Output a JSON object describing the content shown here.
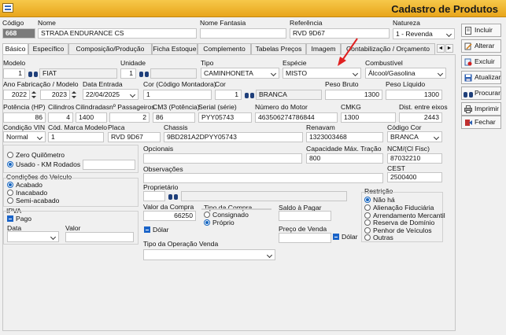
{
  "window": {
    "title": "Cadastro de Produtos"
  },
  "header": {
    "codigo_label": "Código",
    "codigo_value": "668",
    "nome_label": "Nome",
    "nome_value": "STRADA ENDURANCE CS",
    "nome_fantasia_label": "Nome Fantasia",
    "nome_fantasia_value": "",
    "referencia_label": "Referência",
    "referencia_value": "RVD 9D67",
    "natureza_label": "Natureza",
    "natureza_value": "1 - Revenda"
  },
  "tabs": [
    "Básico",
    "Específico",
    "Composição/Produção",
    "Ficha Estoque",
    "Complemento",
    "Tabelas Preços",
    "Imagem",
    "Contabilização / Orçamento"
  ],
  "tabnav": {
    "prev": "◄",
    "next": "►"
  },
  "form": {
    "modelo_label": "Modelo",
    "modelo_code": "1",
    "modelo_value": "FIAT",
    "unidade_label": "Unidade",
    "unidade_value": "1",
    "tipo_label": "Tipo",
    "tipo_value": "CAMINHONETA",
    "especie_label": "Espécie",
    "especie_value": "MISTO",
    "combustivel_label": "Combustível",
    "combustivel_value": "Álcool/Gasolina",
    "ano_label": "Ano Fabricação / Modelo",
    "ano_fab": "2022",
    "ano_mod": "2023",
    "data_entrada_label": "Data Entrada",
    "data_entrada_value": "22/04/2025",
    "cor_montadora_label": "Cor (Código Montadora)",
    "cor_montadora_value": "1",
    "cor_label": "Cor",
    "cor_code": "1",
    "cor_value": "BRANCA",
    "peso_bruto_label": "Peso Bruto",
    "peso_bruto_value": "1300",
    "peso_liquido_label": "Peso Líquido",
    "peso_liquido_value": "1300",
    "potencia_label": "Potência (HP)",
    "potencia_value": "86",
    "cilindros_label": "Cilindros",
    "cilindros_value": "4",
    "cilindradas_label": "Cilindradas",
    "cilindradas_value": "1400",
    "passageiros_label": "nº Passageiros",
    "passageiros_value": "2",
    "cm3_label": "CM3 (Potência)",
    "cm3_value": "86",
    "serial_label": "Serial (série)",
    "serial_value": "PYY05743",
    "motor_label": "Número  do Motor",
    "motor_value": "463506274786844",
    "cmkg_label": "CMKG",
    "cmkg_value": "1300",
    "eixos_label": "Dist. entre eixos",
    "eixos_value": "2443",
    "condicao_vin_label": "Condição VIN",
    "condicao_vin_value": "Normal",
    "marca_modelo_label": "Cód. Marca Modelo",
    "marca_modelo_value": "1",
    "placa_label": "Placa",
    "placa_value": "RVD 9D67",
    "chassis_label": "Chassis",
    "chassis_value": "9BD281A2DPYY05743",
    "renavam_label": "Renavam",
    "renavam_value": "1323003468",
    "codigo_cor_label": "Código Cor",
    "codigo_cor_value": "BRANCA",
    "zero_km_label": "Zero Quilômetro",
    "usado_label": "Usado - KM Rodados",
    "km_value": "",
    "opcionais_label": "Opcionais",
    "opcionais_value": "",
    "capacidade_label": "Capacidade Máx. Tração",
    "capacidade_value": "800",
    "ncm_label": "NCM/(Cl Fisc)",
    "ncm_value": "87032210",
    "condicoes_label": "Condições do Veículo",
    "condicoes": [
      "Acabado",
      "Inacabado",
      "Semi-acabado"
    ],
    "observacoes_label": "Observações",
    "observacoes_value": "",
    "cest_label": "CEST",
    "cest_value": "2500400",
    "proprietario_label": "Proprietário",
    "proprietario_code": "",
    "proprietario_value": "",
    "ipva_label": "IPVA",
    "pago_label": "Pago",
    "data_label": "Data",
    "data_value": "",
    "valor_label": "Valor",
    "valor_value": "",
    "valor_compra_label": "Valor da Compra",
    "valor_compra_value": "66250",
    "dolar_label": "Dólar",
    "tipo_compra_label": "Tipo da Compra",
    "tipo_compra_options": [
      "Consignado",
      "Próprio"
    ],
    "saldo_label": "Saldo à Pagar",
    "saldo_value": "",
    "preco_venda_label": "Preço de Venda",
    "preco_venda_value": "",
    "restricao_label": "Restrição",
    "restricao_options": [
      "Não há",
      "Alienação Fiduciária",
      "Arrendamento Mercantil",
      "Reserva de Domínio",
      "Penhor de Veículos",
      "Outras"
    ],
    "tipo_operacao_label": "Tipo da Operação Venda",
    "tipo_operacao_value": ""
  },
  "buttons": [
    "Incluir",
    "Alterar",
    "Excluir",
    "Atualizar",
    "Procurar",
    "Imprimir",
    "Fechar"
  ],
  "colors": {
    "title_bar": "#f0b535",
    "accent_blue": "#1565c0",
    "arrow": "#e02020"
  }
}
